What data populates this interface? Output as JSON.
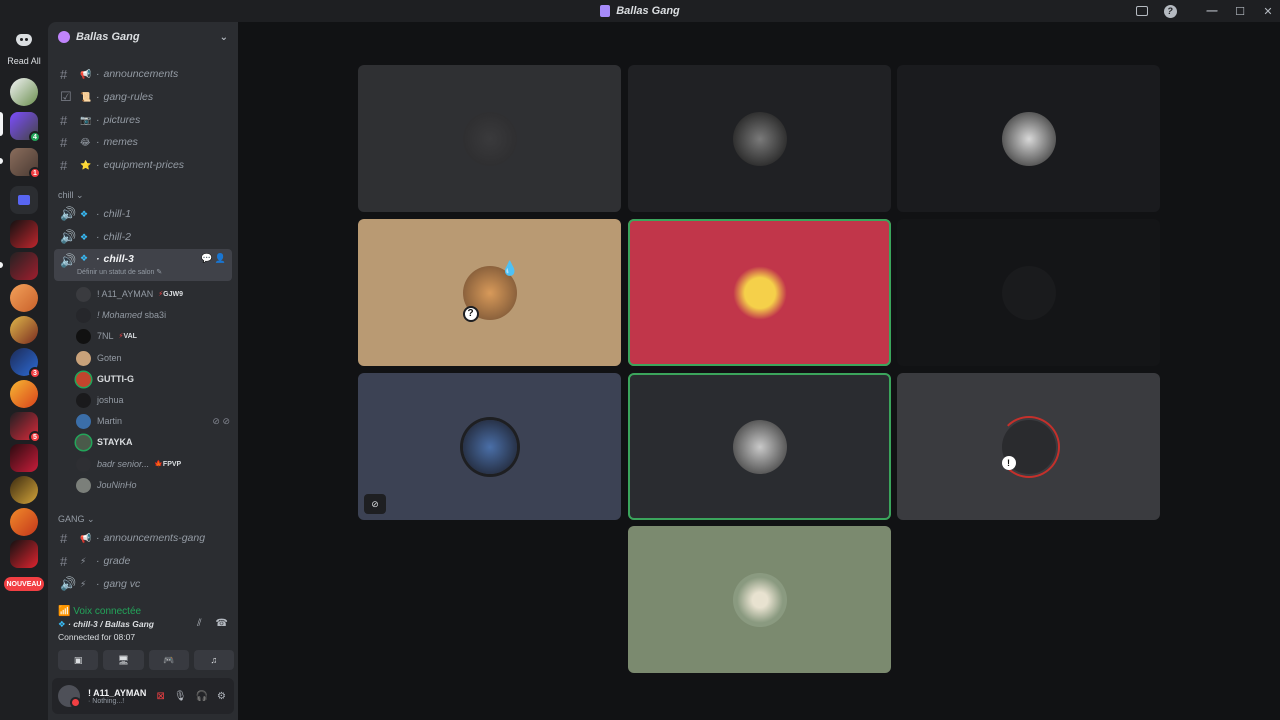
{
  "window": {
    "title": "Ballas Gang"
  },
  "guild_bar": {
    "read_all_label": "Read All",
    "badges": {
      "g2": "4",
      "g3": "1",
      "g10": "3",
      "g12": "5"
    },
    "new_label": "NOUVEAU"
  },
  "server": {
    "name": "Ballas Gang"
  },
  "channels_top": [
    {
      "emoji": "📢",
      "name": "announcements"
    },
    {
      "emoji": "📜",
      "name": "gang-rules"
    },
    {
      "emoji": "📷",
      "name": "pictures"
    },
    {
      "emoji": "😂",
      "name": "memes"
    },
    {
      "emoji": "⭐",
      "name": "equipment-prices"
    }
  ],
  "category_chill": "chill",
  "voice_channels": [
    {
      "name": "chill-1"
    },
    {
      "name": "chill-2"
    },
    {
      "name": "chill-3",
      "status_hint": "Définir un statut de salon"
    }
  ],
  "voice_users": [
    {
      "name": "! A11_AYMAN",
      "tag": "GJW9",
      "style": "normal"
    },
    {
      "name": "! Mohamed",
      "extra": "sba3i",
      "style": "italic"
    },
    {
      "name": "7NL",
      "tag": "VAL",
      "style": "normal"
    },
    {
      "name": "Goten",
      "style": "normal"
    },
    {
      "name": "GUTTI-G",
      "style": "bold"
    },
    {
      "name": "joshua",
      "style": "normal"
    },
    {
      "name": "Martin",
      "style": "normal"
    },
    {
      "name": "STAYKA",
      "style": "bold"
    },
    {
      "name": "badr senior...",
      "tag": "FPVP",
      "style": "italic"
    },
    {
      "name": "JouNinHo",
      "style": "italic"
    }
  ],
  "category_gang": "GANG",
  "channels_gang": [
    {
      "emoji": "📢",
      "name": "announcements-gang"
    },
    {
      "emoji": "⚡",
      "name": "grade"
    },
    {
      "emoji": "⚡",
      "name": "gang vc"
    }
  ],
  "voice_connection": {
    "status": "Voix connectée",
    "channel": "chill-3 / Ballas Gang",
    "connected_for_label": "Connected for",
    "elapsed": "08:07"
  },
  "user": {
    "name": "! A11_AYMAN",
    "status": "Nothing...!"
  },
  "colors": {
    "accent_green": "#23a55a",
    "danger_red": "#f23f43",
    "tile_tan": "#b99a73",
    "tile_red": "#c1364a",
    "tile_slate": "#3c4254",
    "tile_olive": "#7b8a6f"
  }
}
